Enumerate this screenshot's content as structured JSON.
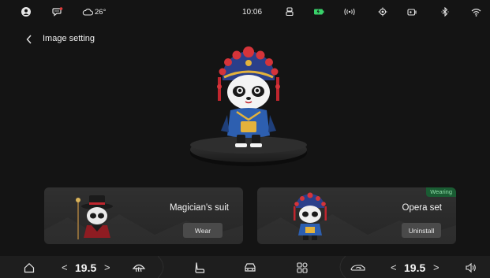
{
  "status": {
    "weather": "26°",
    "time": "10:06"
  },
  "header": {
    "title": "Image setting"
  },
  "cards": [
    {
      "title": "Magician's suit",
      "button": "Wear",
      "badge": ""
    },
    {
      "title": "Opera set",
      "button": "Uninstall",
      "badge": "Wearing"
    }
  ],
  "dock": {
    "left_temp": "19.5",
    "right_temp": "19.5",
    "left_arrow": "<",
    "right_arrow": ">"
  },
  "colors": {
    "background": "#141414",
    "card": "#2b2b2b",
    "badge_bg": "#1a5c33",
    "badge_text": "#8fdca8",
    "battery": "#39d16a"
  }
}
